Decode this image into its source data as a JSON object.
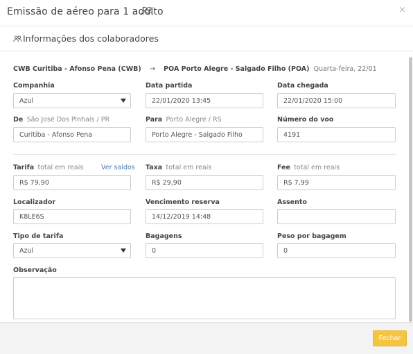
{
  "modal": {
    "title": "Emissão de aéreo para 1 adulto",
    "close": "×",
    "section_tab": "Informações dos colaboradores"
  },
  "route": {
    "origin": "CWB Curitiba - Afonso Pena (CWB)",
    "arrow": "→",
    "destination": "POA Porto Alegre - Salgado Filho (POA)",
    "date": "Quarta-feira, 22/01"
  },
  "fields": {
    "companhia": {
      "label": "Companhia",
      "value": "Azul"
    },
    "data_partida": {
      "label": "Data partida",
      "value": "22/01/2020 13:45"
    },
    "data_chegada": {
      "label": "Data chegada",
      "value": "22/01/2020 15:00"
    },
    "de": {
      "label": "De",
      "sub": "São José Dos Pinhais / PR",
      "value": "Curitiba - Afonso Pena"
    },
    "para": {
      "label": "Para",
      "sub": "Porto Alegre / RS",
      "value": "Porto Alegre - Salgado Filho"
    },
    "numero_voo": {
      "label": "Número do voo",
      "value": "4191"
    },
    "tarifa": {
      "label": "Tarifa",
      "sub": "total em reais",
      "link": "Ver saldos",
      "value": "R$ 79,90"
    },
    "taxa": {
      "label": "Taxa",
      "sub": "total em reais",
      "value": "R$ 29,90"
    },
    "fee": {
      "label": "Fee",
      "sub": "total em reais",
      "value": "R$ 7,99"
    },
    "localizador": {
      "label": "Localizador",
      "value": "K8LE6S"
    },
    "vencimento": {
      "label": "Vencimento reserva",
      "value": "14/12/2019 14:48"
    },
    "assento": {
      "label": "Assento",
      "value": ""
    },
    "tipo_tarifa": {
      "label": "Tipo de tarifa",
      "value": "Azul"
    },
    "bagagens": {
      "label": "Bagagens",
      "value": "0"
    },
    "peso_bagagem": {
      "label": "Peso por bagagem",
      "value": "0"
    },
    "observacao": {
      "label": "Observação",
      "value": ""
    }
  },
  "footer": {
    "close_button": "Fechar"
  },
  "colors": {
    "accent": "#f5c542",
    "link": "#4a7ca8",
    "border": "#cccccc"
  },
  "icons": {
    "title_icon": "people-icon",
    "section_icon": "people-icon",
    "select_caret": "caret-down-icon"
  }
}
